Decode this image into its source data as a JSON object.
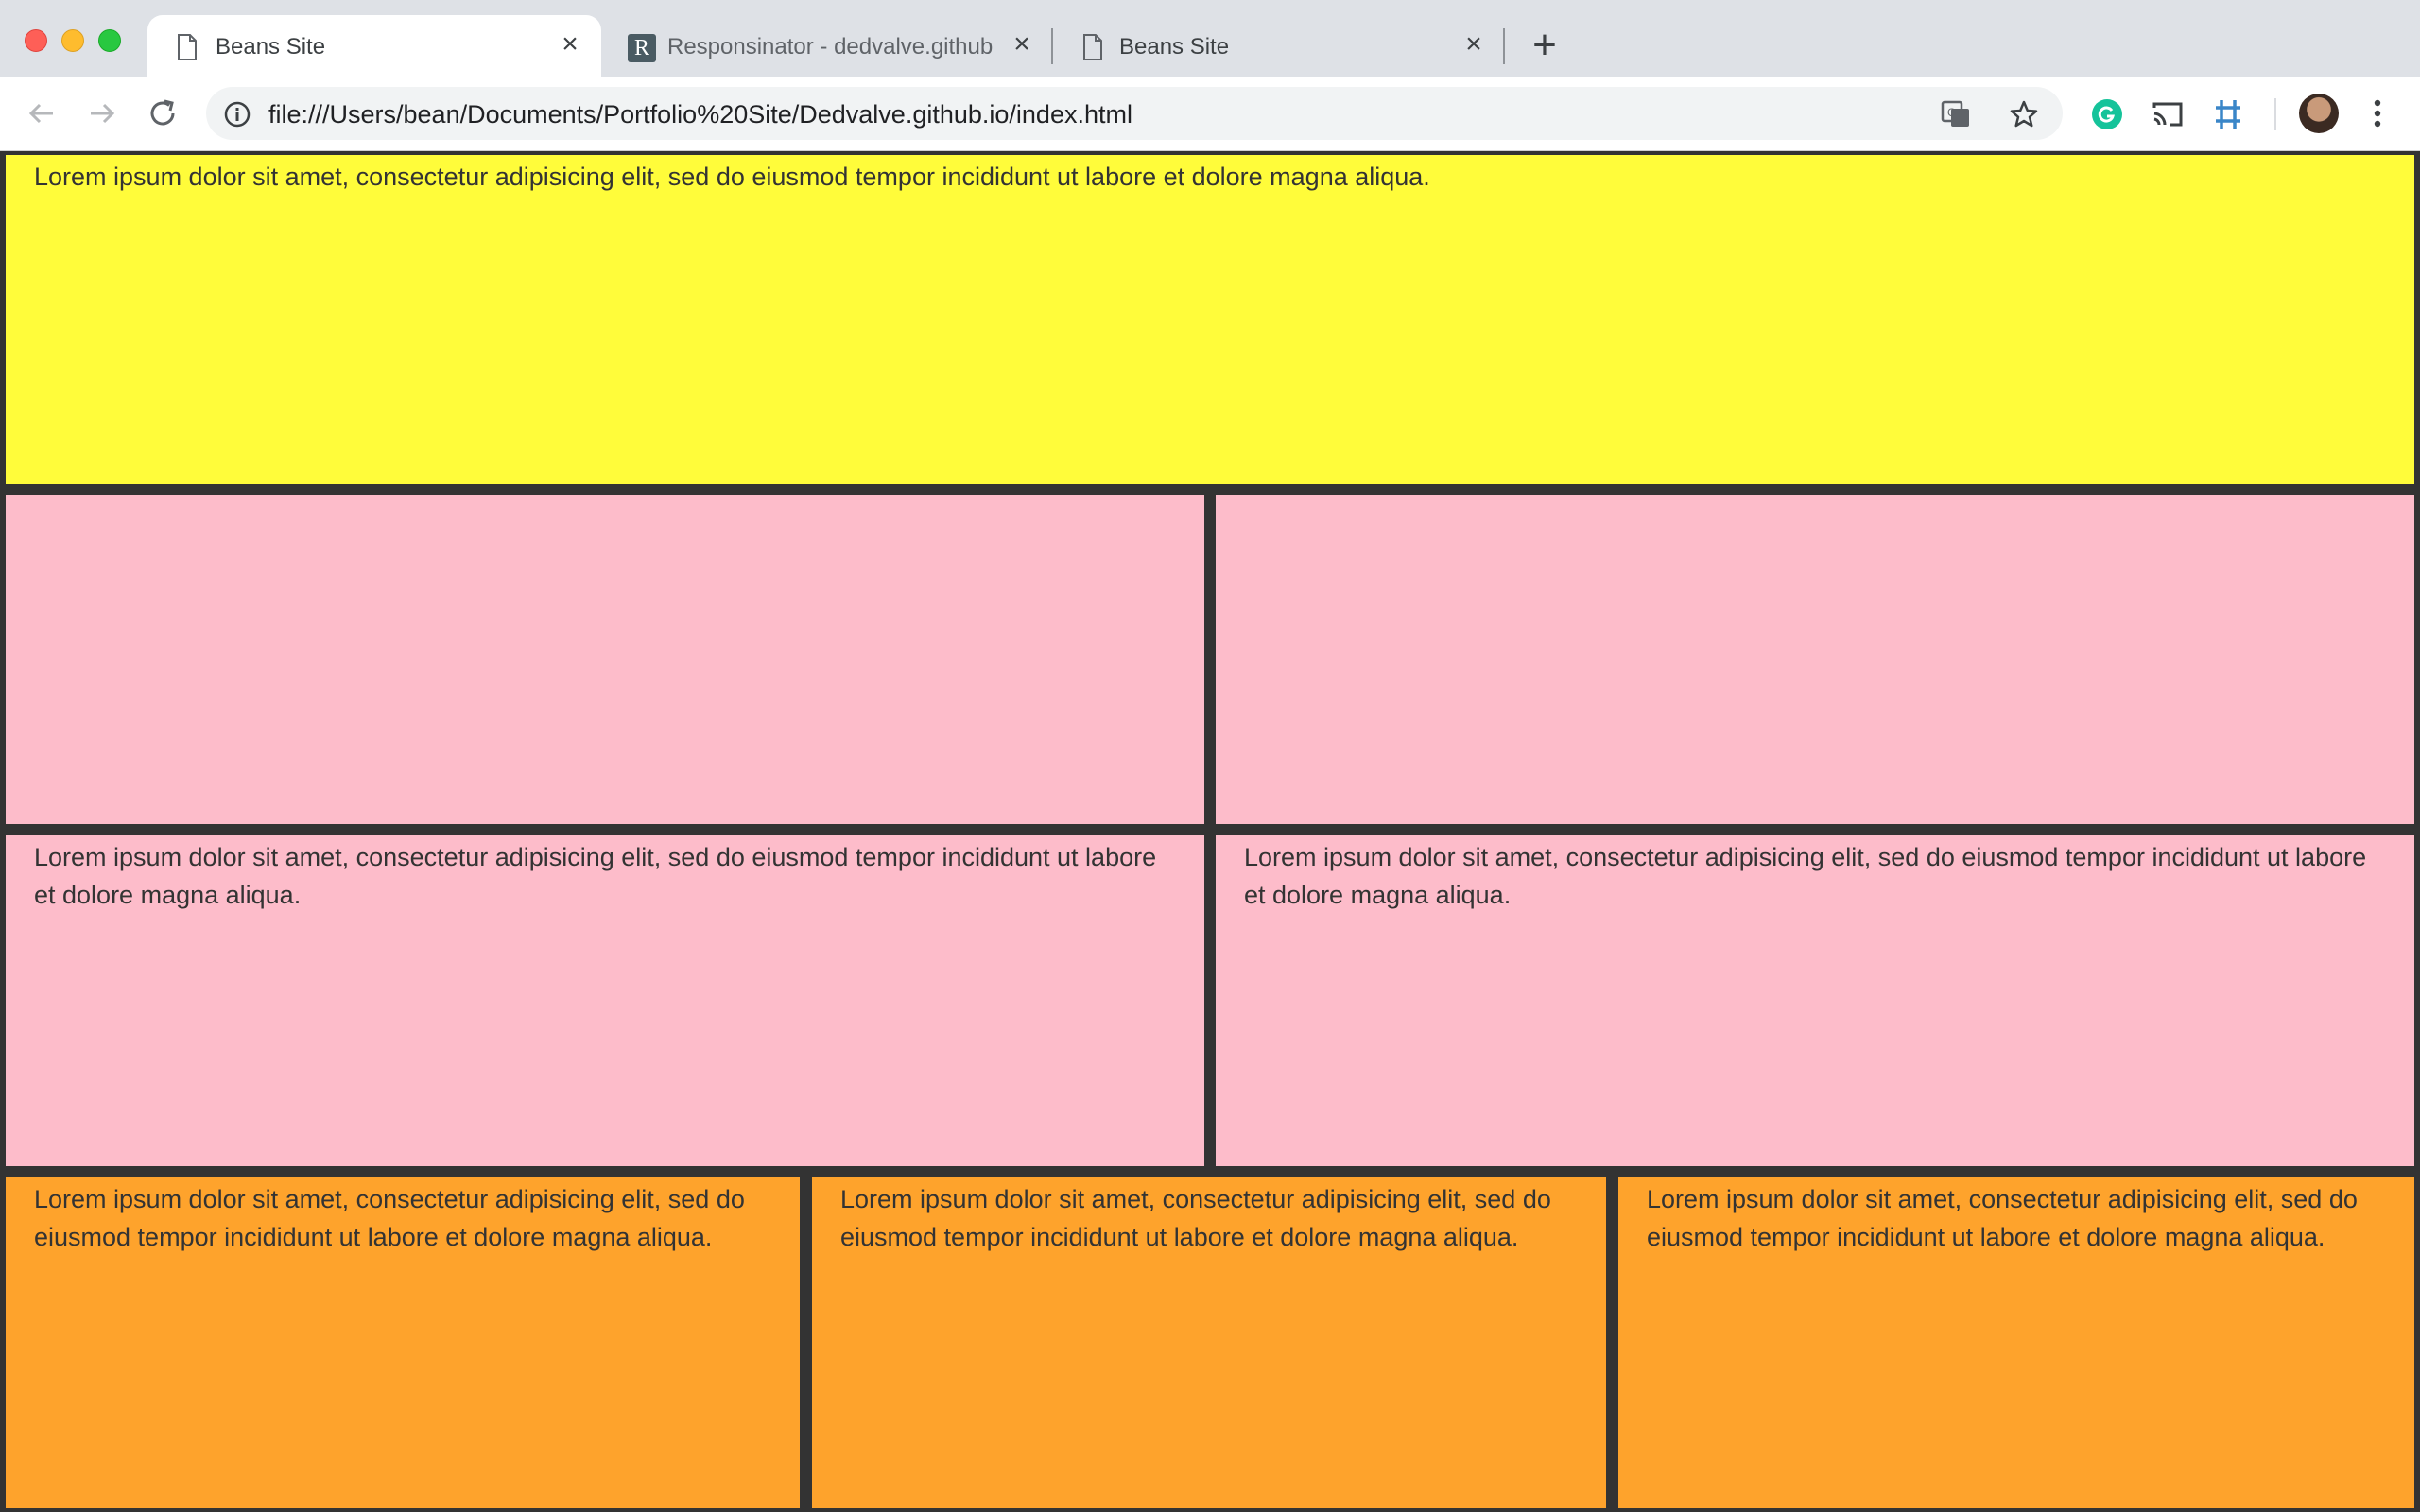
{
  "browser": {
    "tabs": [
      {
        "title": "Beans Site",
        "active": true,
        "icon": "page-icon"
      },
      {
        "title": "Responsinator - dedvalve.github",
        "active": false,
        "icon": "responsinator-r-icon"
      },
      {
        "title": "Beans Site",
        "active": false,
        "icon": "page-icon"
      }
    ],
    "new_tab_label": "+",
    "url": "file:///Users/bean/Documents/Portfolio%20Site/Dedvalve.github.io/index.html",
    "r_glyph": "R"
  },
  "page": {
    "header": {
      "text": "Lorem ipsum dolor sit amet, consectetur adipisicing elit, sed do eiusmod tempor incididunt ut labore et dolore magna aliqua.",
      "color": "#fffc3a"
    },
    "row2": [
      {
        "text": "",
        "color": "#fdbcca"
      },
      {
        "text": "",
        "color": "#fdbcca"
      }
    ],
    "row3": [
      {
        "text": "Lorem ipsum dolor sit amet, consectetur adipisicing elit, sed do eiusmod tempor incididunt ut labore et dolore magna aliqua.",
        "color": "#fdbcca"
      },
      {
        "text": "Lorem ipsum dolor sit amet, consectetur adipisicing elit, sed do eiusmod tempor incididunt ut labore et dolore magna aliqua.",
        "color": "#fdbcca"
      }
    ],
    "row4": [
      {
        "text": "Lorem ipsum dolor sit amet, consectetur adipisicing elit, sed do eiusmod tempor incididunt ut labore et dolore magna aliqua.",
        "color": "#fea32c"
      },
      {
        "text": "Lorem ipsum dolor sit amet, consectetur adipisicing elit, sed do eiusmod tempor incididunt ut labore et dolore magna aliqua.",
        "color": "#fea32c"
      },
      {
        "text": "Lorem ipsum dolor sit amet, consectetur adipisicing elit, sed do eiusmod tempor incididunt ut labore et dolore magna aliqua.",
        "color": "#fea32c"
      }
    ],
    "background": "#333333"
  }
}
